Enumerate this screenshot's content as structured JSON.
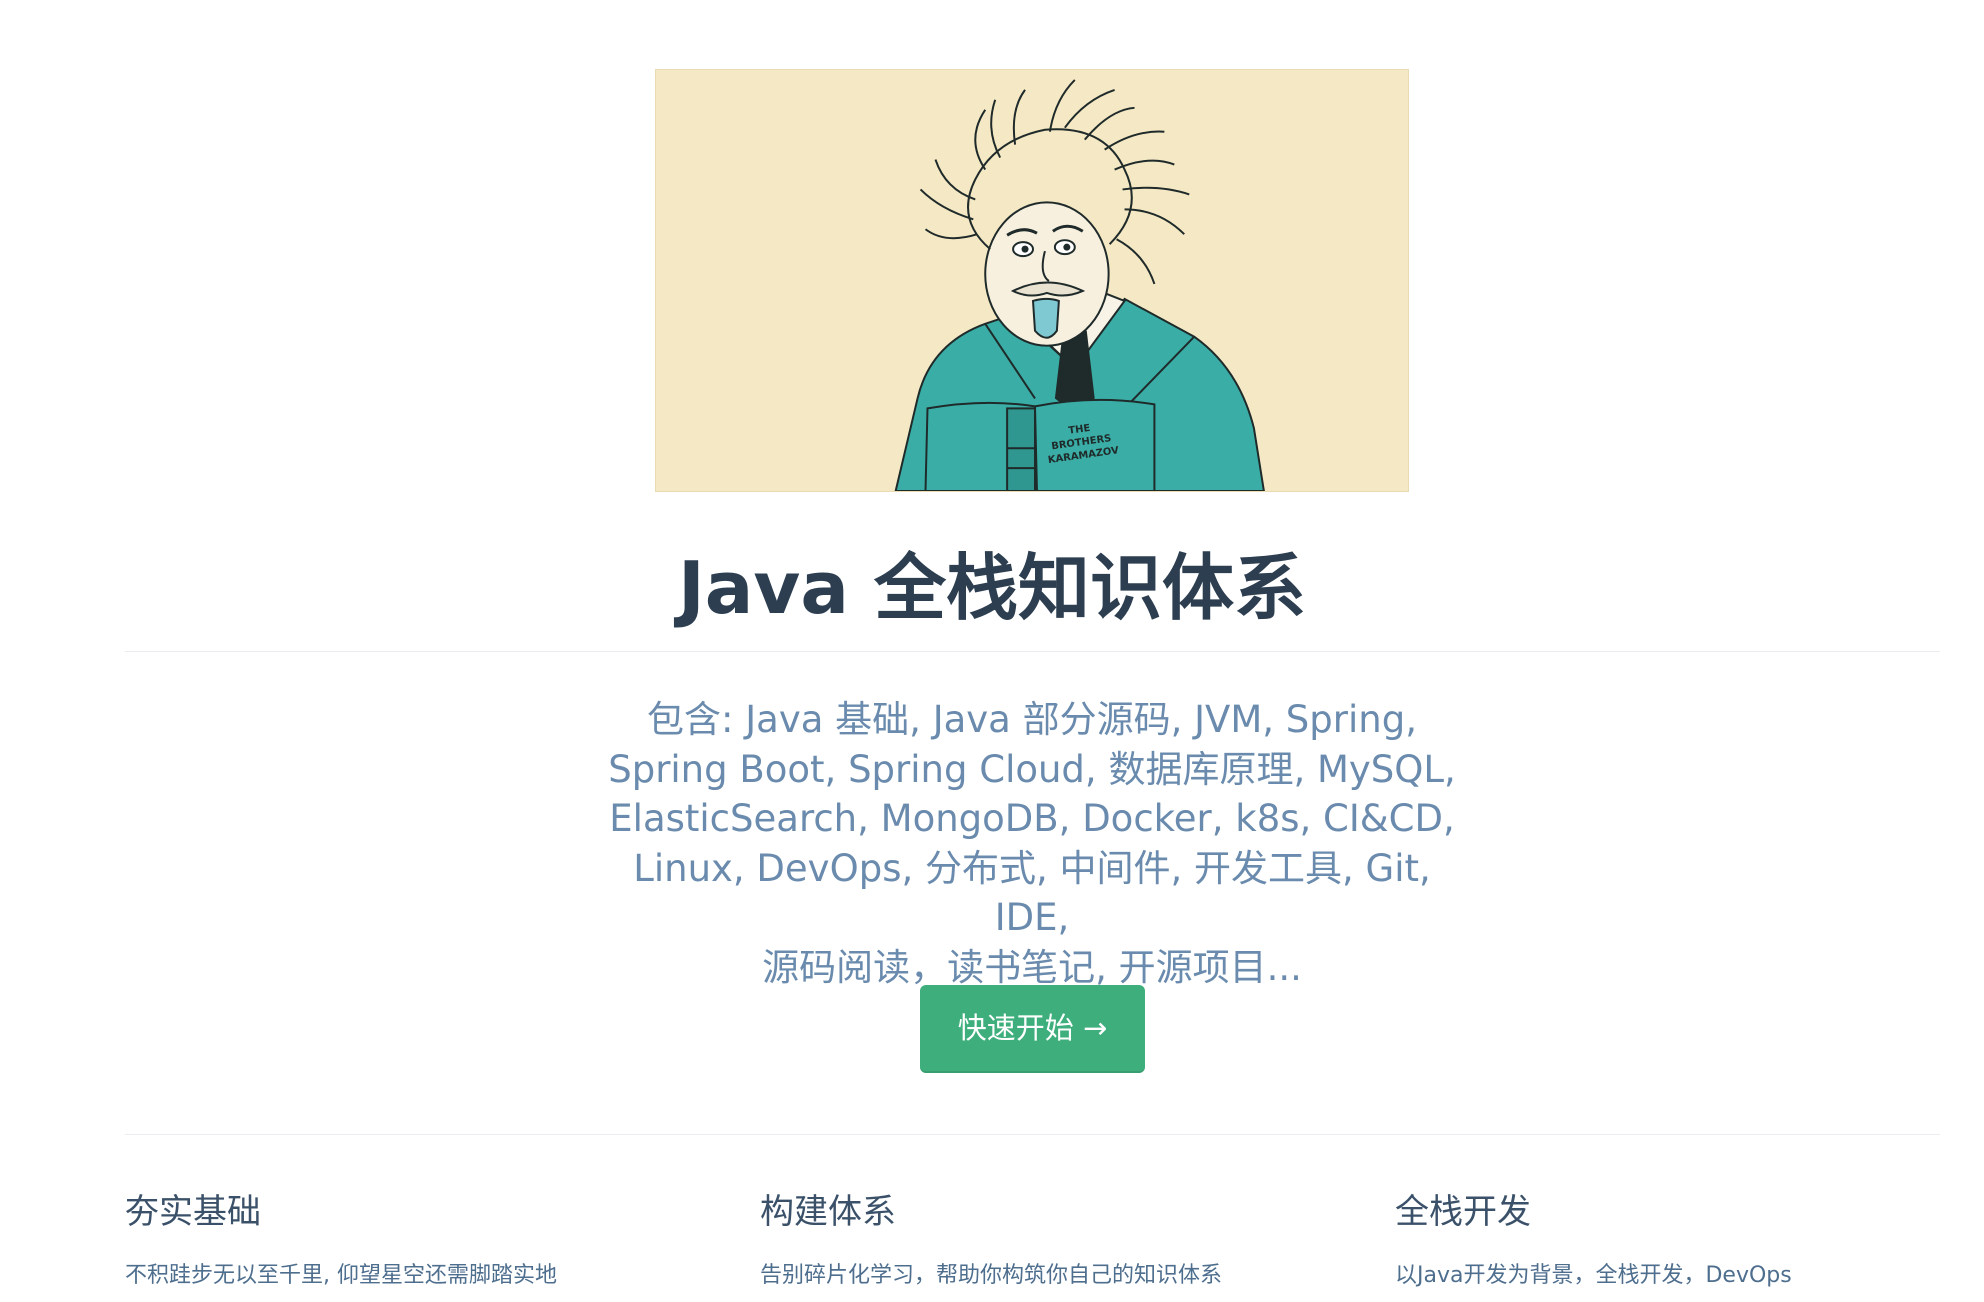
{
  "hero": {
    "image_alt": "Einstein with tongue out holding book",
    "book_title_line1": "THE",
    "book_title_line2": "BROTHERS",
    "book_title_line3": "KARAMAZOV",
    "title": "Java 全栈知识体系",
    "description_lines": [
      "包含: Java 基础, Java 部分源码, JVM, Spring,",
      "Spring Boot, Spring Cloud, 数据库原理, MySQL,",
      "ElasticSearch, MongoDB, Docker, k8s, CI&CD,",
      "Linux, DevOps, 分布式, 中间件, 开发工具, Git, IDE,",
      "源码阅读，读书笔记, 开源项目..."
    ],
    "action_label": "快速开始 →"
  },
  "features": [
    {
      "title": "夯实基础",
      "details": "不积跬步无以至千里, 仰望星空还需脚踏实地"
    },
    {
      "title": "构建体系",
      "details": "告别碎片化学习，帮助你构筑你自己的知识体系"
    },
    {
      "title": "全栈开发",
      "details": "以Java开发为背景，全栈开发，DevOps"
    }
  ],
  "colors": {
    "accent": "#3eaf7c",
    "title": "#2c3e50",
    "description": "#6a8bad",
    "image_bg": "#f5e8c4",
    "jacket": "#3aaea6"
  }
}
